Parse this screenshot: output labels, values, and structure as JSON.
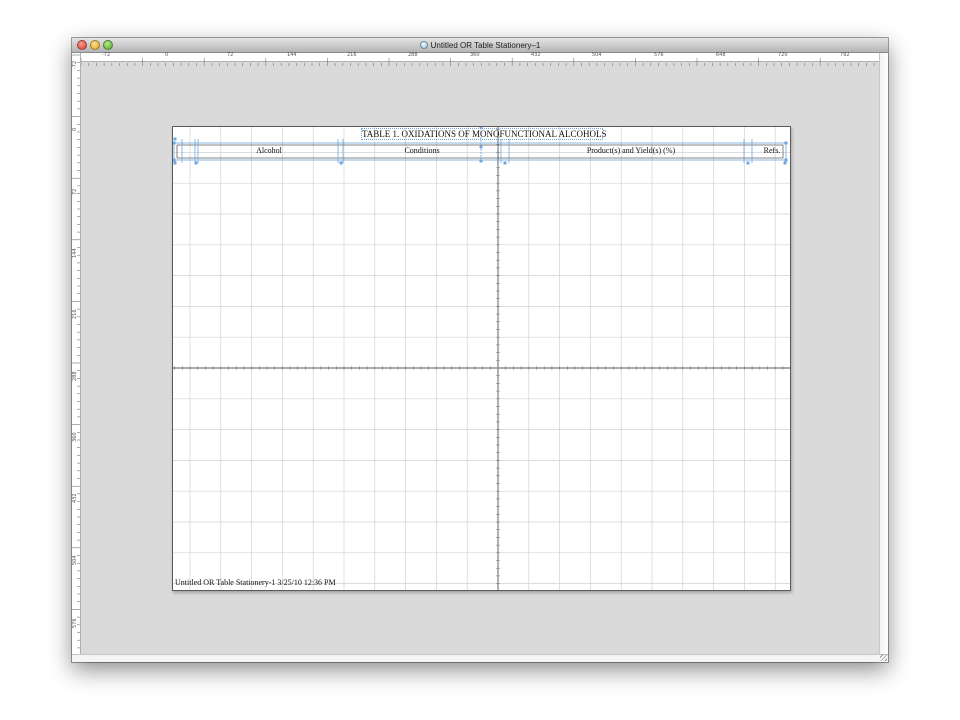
{
  "window": {
    "title": "Untitled OR Table Stationery–1"
  },
  "rulers": {
    "horizontal": [
      "-72",
      "0",
      "72",
      "144",
      "216",
      "288",
      "360",
      "432",
      "504",
      "576",
      "648",
      "720",
      "792"
    ],
    "vertical": [
      "-72",
      "0",
      "72",
      "144",
      "216",
      "288",
      "360",
      "432",
      "504",
      "576"
    ]
  },
  "table": {
    "title": "TABLE 1. OXIDATIONS OF MONOFUNCTIONAL ALCOHOLS",
    "columns": [
      "Alcohol",
      "Conditions",
      "Product(s) and Yield(s) (%)",
      "Refs."
    ]
  },
  "footer": {
    "text": "Untitled OR Table Stationery-1 3/25/10 12:36 PM"
  },
  "colors": {
    "selection_blue": "#6fa6dc",
    "grid_line": "#cccccc",
    "canvas_bg": "#dadada"
  }
}
